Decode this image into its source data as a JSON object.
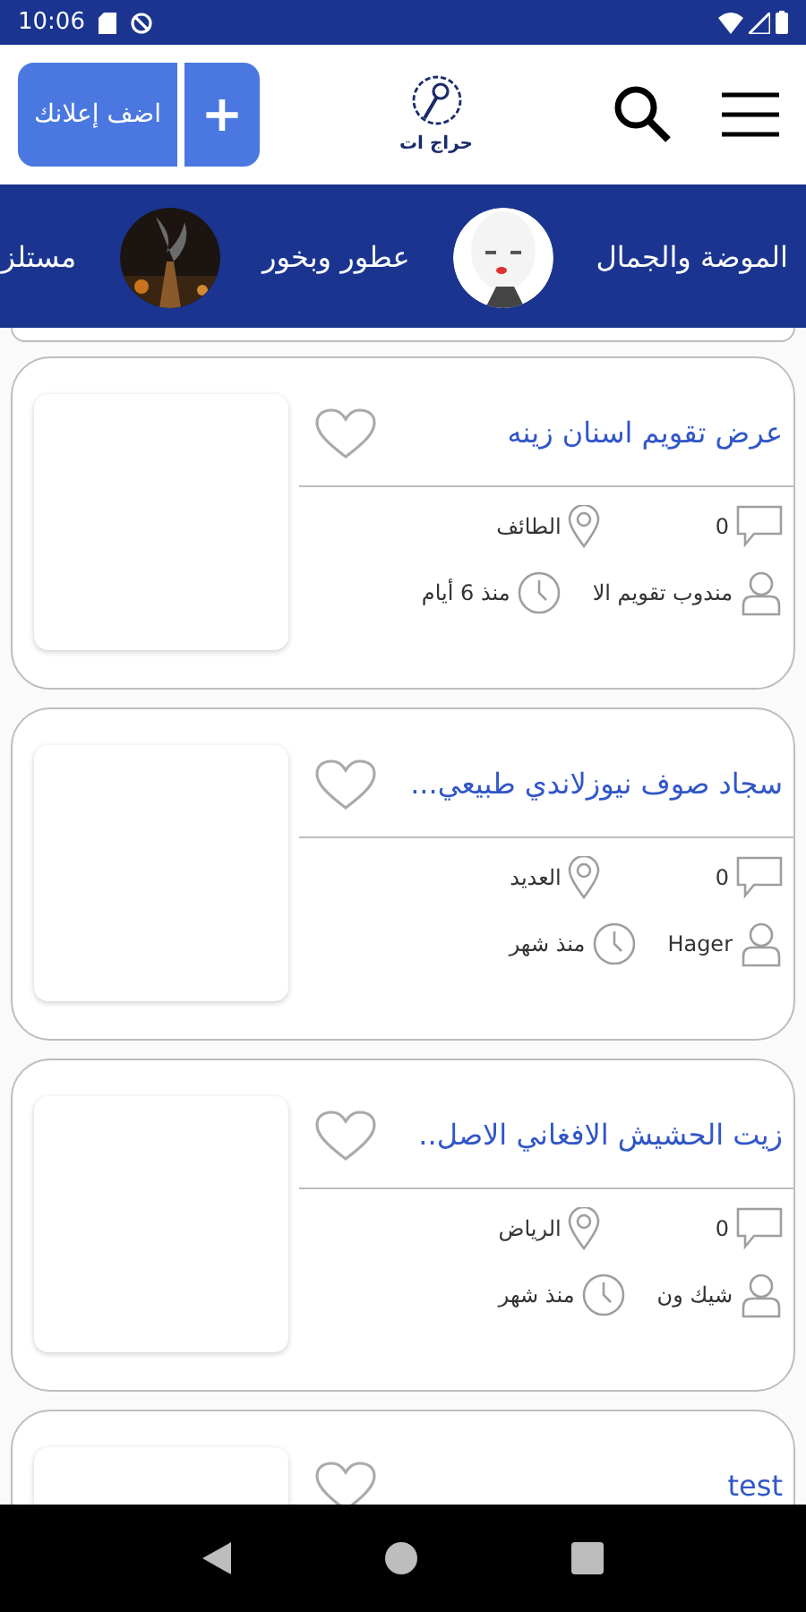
{
  "status_bar": {
    "time": "10:06"
  },
  "header": {
    "add_button": {
      "label": "اضف إعلانك",
      "plus": "+"
    },
    "logo_text": "حراج ات"
  },
  "categories": [
    {
      "label": "الموضة والجمال",
      "kind": "text"
    },
    {
      "kind": "avatar"
    },
    {
      "label": "عطور وبخور",
      "kind": "text"
    },
    {
      "kind": "avatar"
    },
    {
      "label": "مستلز",
      "kind": "text"
    }
  ],
  "listings": [
    {
      "title": "عرض تقويم اسنان زينه",
      "comments": "0",
      "city": "الطائف",
      "user": "مندوب تقويم الا",
      "time": "منذ 6 أيام",
      "favorite": false
    },
    {
      "title": "سجاد صوف نيوزلاندي طبيعي...",
      "comments": "0",
      "city": "العديد",
      "user": "Hager",
      "time": "منذ شهر",
      "favorite": false
    },
    {
      "title": "زيت الحشيش الافغاني الاصل..",
      "comments": "0",
      "city": "الرياض",
      "user": "شيك ون",
      "time": "منذ شهر",
      "favorite": false
    },
    {
      "title": "test",
      "favorite": false
    }
  ]
}
